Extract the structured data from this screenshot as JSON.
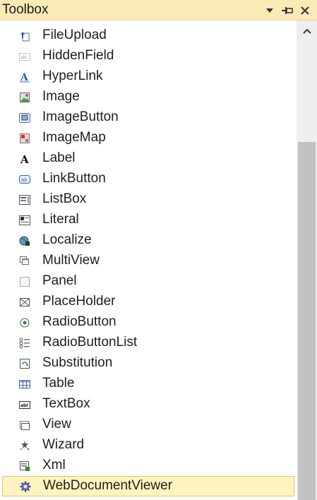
{
  "window": {
    "title": "Toolbox"
  },
  "toolbox": {
    "items": [
      {
        "label": "FileUpload",
        "icon": "file-upload-icon"
      },
      {
        "label": "HiddenField",
        "icon": "hidden-field-icon"
      },
      {
        "label": "HyperLink",
        "icon": "hyperlink-icon"
      },
      {
        "label": "Image",
        "icon": "image-icon"
      },
      {
        "label": "ImageButton",
        "icon": "image-button-icon"
      },
      {
        "label": "ImageMap",
        "icon": "image-map-icon"
      },
      {
        "label": "Label",
        "icon": "label-icon"
      },
      {
        "label": "LinkButton",
        "icon": "link-button-icon"
      },
      {
        "label": "ListBox",
        "icon": "listbox-icon"
      },
      {
        "label": "Literal",
        "icon": "literal-icon"
      },
      {
        "label": "Localize",
        "icon": "localize-icon"
      },
      {
        "label": "MultiView",
        "icon": "multiview-icon"
      },
      {
        "label": "Panel",
        "icon": "panel-icon"
      },
      {
        "label": "PlaceHolder",
        "icon": "placeholder-icon"
      },
      {
        "label": "RadioButton",
        "icon": "radio-button-icon"
      },
      {
        "label": "RadioButtonList",
        "icon": "radio-button-list-icon"
      },
      {
        "label": "Substitution",
        "icon": "substitution-icon"
      },
      {
        "label": "Table",
        "icon": "table-icon"
      },
      {
        "label": "TextBox",
        "icon": "textbox-icon"
      },
      {
        "label": "View",
        "icon": "view-icon"
      },
      {
        "label": "Wizard",
        "icon": "wizard-icon"
      },
      {
        "label": "Xml",
        "icon": "xml-icon"
      },
      {
        "label": "WebDocumentViewer",
        "icon": "gear-icon"
      }
    ],
    "selected_index": 22
  },
  "colors": {
    "title_bg": "#fbe9b6",
    "selection_bg": "#fdf4bf",
    "selection_border": "#e5c365"
  }
}
